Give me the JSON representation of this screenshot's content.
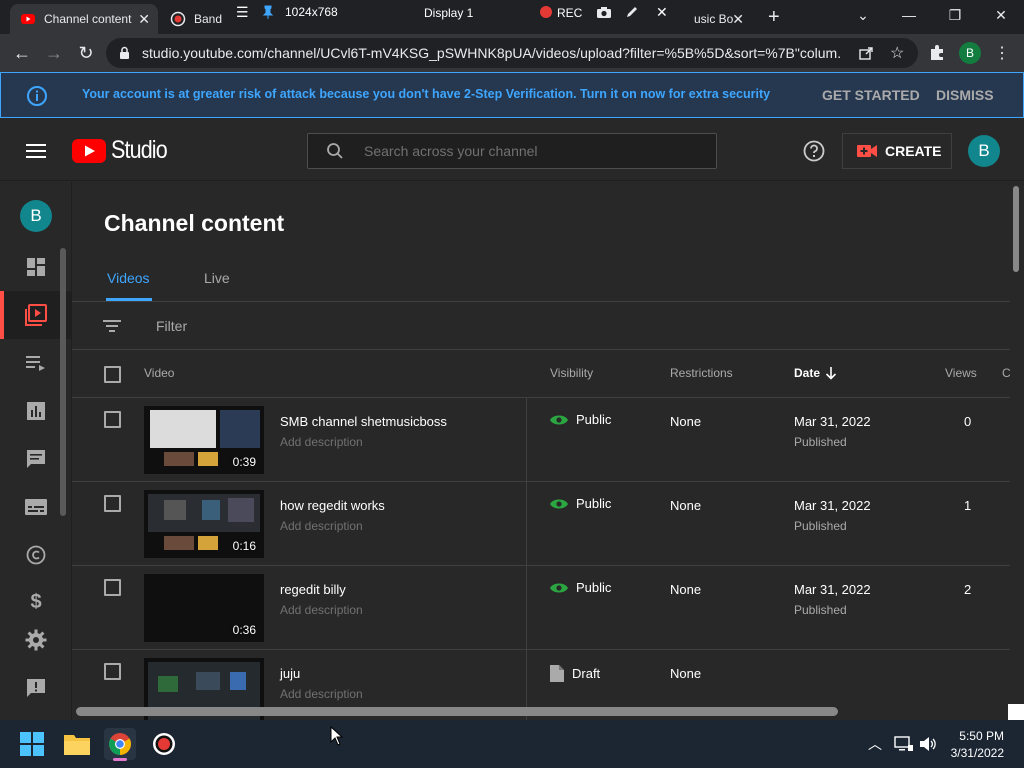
{
  "browser": {
    "tabs": [
      {
        "title": "Channel content",
        "active": true
      },
      {
        "title": "Band",
        "active": false
      },
      {
        "title": "usic Bo",
        "active": false
      }
    ],
    "recorder": {
      "resolution": "1024x768",
      "display": "Display 1",
      "rec": "REC"
    },
    "url": "studio.youtube.com/channel/UCvl6T-mV4KSG_pSWHNK8pUA/videos/upload?filter=%5B%5D&sort=%7B\"colum...",
    "profile_initial": "B"
  },
  "banner": {
    "message": "Your account is at greater risk of attack because you don't have 2-Step Verification. Turn it on now for extra security",
    "get_started": "GET STARTED",
    "dismiss": "DISMISS"
  },
  "header": {
    "logo_text": "Studio",
    "search_placeholder": "Search across your channel",
    "create_label": "CREATE",
    "avatar_initial": "B"
  },
  "sidebar": {
    "avatar_initial": "B"
  },
  "main": {
    "title": "Channel content",
    "tabs": [
      {
        "label": "Videos",
        "active": true
      },
      {
        "label": "Live",
        "active": false
      }
    ],
    "filter_label": "Filter",
    "columns": {
      "video": "Video",
      "visibility": "Visibility",
      "restrictions": "Restrictions",
      "date": "Date",
      "views": "Views",
      "comments": "C"
    },
    "rows": [
      {
        "title": "SMB channel shetmusicboss",
        "description": "Add description",
        "duration": "0:39",
        "visibility": "Public",
        "restrictions": "None",
        "date": "Mar 31, 2022",
        "status": "Published",
        "views": "0"
      },
      {
        "title": "how regedit works",
        "description": "Add description",
        "duration": "0:16",
        "visibility": "Public",
        "restrictions": "None",
        "date": "Mar 31, 2022",
        "status": "Published",
        "views": "1"
      },
      {
        "title": "regedit billy",
        "description": "Add description",
        "duration": "0:36",
        "visibility": "Public",
        "restrictions": "None",
        "date": "Mar 31, 2022",
        "status": "Published",
        "views": "2"
      },
      {
        "title": "juju",
        "description": "Add description",
        "duration": "",
        "visibility": "Draft",
        "restrictions": "None",
        "date": "",
        "status": "",
        "views": ""
      }
    ]
  },
  "taskbar": {
    "time": "5:50 PM",
    "date": "3/31/2022"
  },
  "colors": {
    "accent": "#3ea6ff",
    "youtube_red": "#ff0000",
    "public_green": "#2ba640",
    "bg": "#282828"
  }
}
